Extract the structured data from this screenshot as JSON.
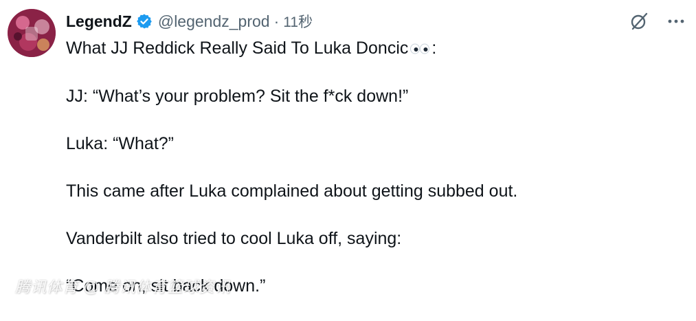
{
  "author": {
    "display_name": "LegendZ",
    "handle": "@legendz_prod",
    "separator": "·",
    "time": "11秒",
    "verified": true,
    "verified_color": "#1d9bf0"
  },
  "icons": {
    "verified": "verified-badge-icon",
    "grok": "grok-icon",
    "more": "more-icon",
    "eyes": "eyes-emoji-icon"
  },
  "tweet": {
    "title_before_emoji": "What JJ Reddick Really Said To Luka Doncic",
    "title_after_emoji": ":",
    "paragraphs": [
      "JJ: “What’s your problem? Sit the f*ck down!”",
      "Luka: “What?”",
      "This came after Luka complained about getting subbed out.",
      "Vanderbilt also tried to cool Luka off, saying:",
      "“Come on, sit back down.”"
    ]
  },
  "watermark": {
    "text": "腾讯体育 @ 腾讯体育篮球资讯"
  },
  "colors": {
    "text": "#0f1419",
    "secondary": "#536471",
    "accent": "#1d9bf0"
  }
}
